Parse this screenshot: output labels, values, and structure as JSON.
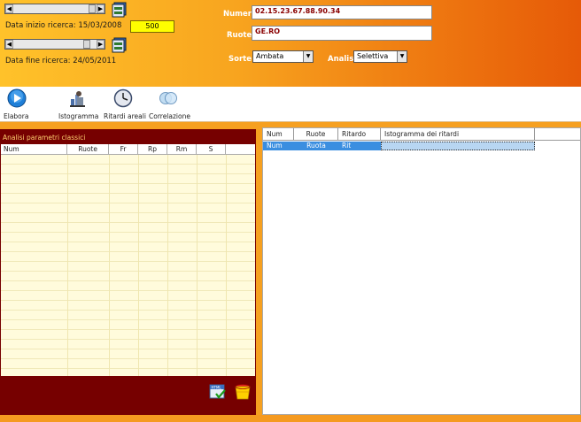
{
  "header": {
    "date_start_label": "Data inizio ricerca:",
    "date_start_value": "15/03/2008",
    "date_end_label": "Data fine ricerca:",
    "date_end_value": "24/05/2011",
    "count_value": "500",
    "numeri_label": "Numeri:",
    "numeri_value": "02.15.23.67.88.90.34",
    "ruote_label": "Ruote:",
    "ruote_value": "GE.RO",
    "sorte_label": "Sorte:",
    "sorte_value": "Ambata",
    "analisi_label": "Analisi:",
    "analisi_value": "Selettiva"
  },
  "toolbar": {
    "items": [
      {
        "label": "Elabora",
        "icon": "play-icon"
      },
      {
        "label": "Istogramma",
        "icon": "chart-user-icon"
      },
      {
        "label": "Ritardi areali",
        "icon": "clock-icon"
      },
      {
        "label": "Correlazione",
        "icon": "venn-icon"
      }
    ]
  },
  "left_panel": {
    "title": "Analisi parametri classici",
    "columns": [
      "Num",
      "Ruote",
      "Fr",
      "Rp",
      "Rm",
      "S"
    ]
  },
  "right_panel": {
    "columns": [
      "Num",
      "Ruote",
      "Ritardo",
      "Istogramma dei ritardi"
    ],
    "row": [
      "Num",
      "Ruota",
      "Rit",
      ""
    ]
  },
  "colors": {
    "header_gradient_start": "#ffc22a",
    "header_gradient_end": "#e65a08",
    "left_panel_bg": "#760000",
    "grid_bg": "#fffbdc",
    "selection": "#3a8ee0"
  }
}
